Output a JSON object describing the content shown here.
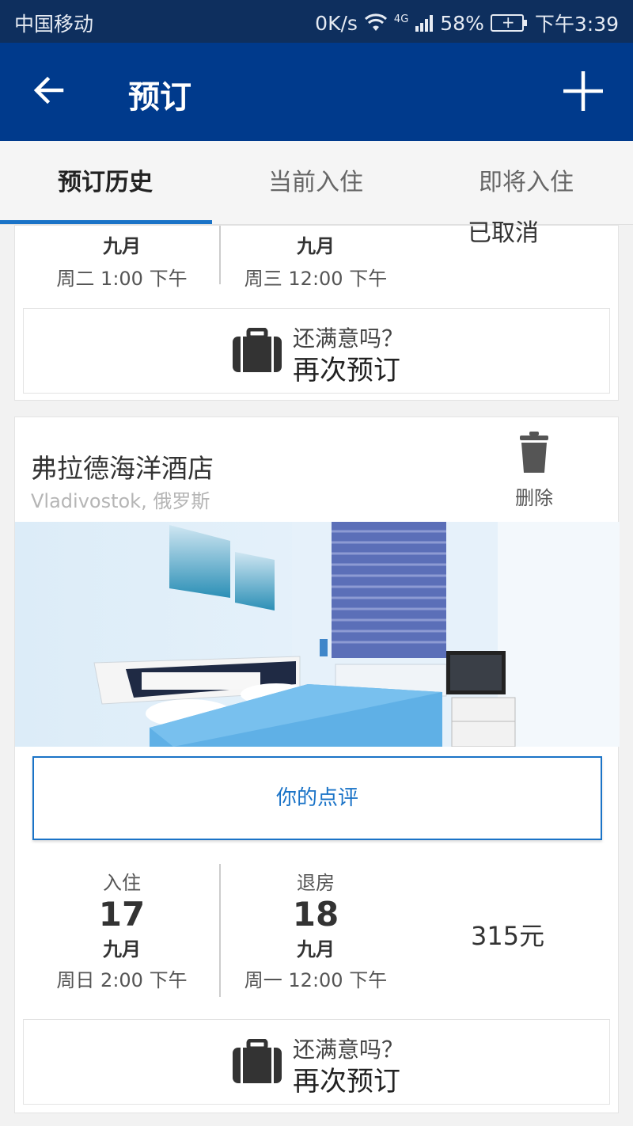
{
  "status_bar": {
    "carrier": "中国移动",
    "right_text": "0K/s",
    "network": "4G",
    "battery": "58%",
    "time": "下午3:39"
  },
  "app_bar": {
    "title": "预订",
    "back_icon": "arrow-back-icon",
    "add_icon": "plus-icon"
  },
  "tabs": [
    {
      "label": "预订历史",
      "active": true
    },
    {
      "label": "当前入住",
      "active": false
    },
    {
      "label": "即将入住",
      "active": false
    }
  ],
  "booking_prev": {
    "status_partial": "已取消",
    "checkin": {
      "month": "九月",
      "time": "周二 1:00 下午"
    },
    "checkout": {
      "month": "九月",
      "time": "周三 12:00 下午"
    },
    "rebook": {
      "question": "还满意吗？",
      "action": "再次预订"
    }
  },
  "booking": {
    "hotel_name": "弗拉德海洋酒店",
    "location": "Vladivostok, 俄罗斯",
    "delete_label": "删除",
    "review_label": "你的点评",
    "checkin": {
      "label": "入住",
      "day": "17",
      "month": "九月",
      "time": "周日 2:00 下午"
    },
    "checkout": {
      "label": "退房",
      "day": "18",
      "month": "九月",
      "time": "周一 12:00 下午"
    },
    "price": "315元",
    "rebook": {
      "question": "还满意吗？",
      "action": "再次预订"
    }
  },
  "colors": {
    "status_bar": "#0e2f5e",
    "app_bar": "#003a8c",
    "accent": "#1a73c7"
  }
}
